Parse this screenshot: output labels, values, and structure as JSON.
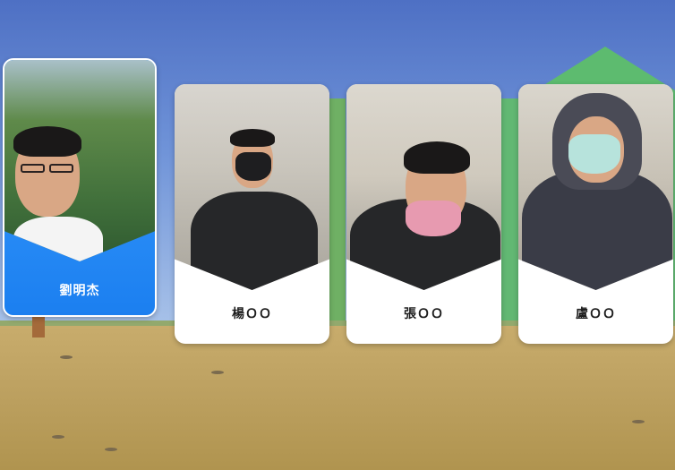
{
  "players": [
    {
      "name": "劉明杰",
      "selected": true
    },
    {
      "name": "楊ＯＯ",
      "selected": false
    },
    {
      "name": "張ＯＯ",
      "selected": false
    },
    {
      "name": "盧ＯＯ",
      "selected": false
    }
  ],
  "colors": {
    "selected_card": "#1b7ff0",
    "card": "#ffffff",
    "ground": "#c8ac6c",
    "sky": "#6f93d8"
  }
}
